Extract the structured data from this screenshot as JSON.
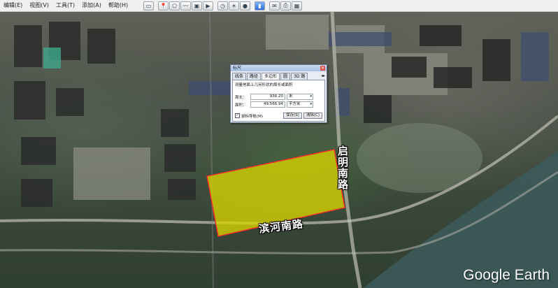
{
  "menu": [
    "编辑(E)",
    "视图(V)",
    "工具(T)",
    "添加(A)",
    "帮助(H)"
  ],
  "toolbar": {
    "icons": [
      "sidebar-icon",
      "placemark-icon",
      "polygon-icon",
      "path-icon",
      "overlay-icon",
      "tour-icon",
      "history-icon",
      "sun-icon",
      "planet-icon",
      "ruler-icon",
      "email-icon",
      "print-icon",
      "map-icon"
    ],
    "active_index": 9
  },
  "dialog": {
    "title": "标尺",
    "tabs": [
      "线条",
      "路径",
      "多边形",
      "圆",
      "3D 路"
    ],
    "active_tab": 2,
    "description": "测量地面上几何形状的周长或面积",
    "perimeter": {
      "label": "周长：",
      "value": "936.20",
      "unit": "米"
    },
    "area": {
      "label": "面积：",
      "value": "49,566.94",
      "unit": "平方米"
    },
    "mouse_nav_label": "鼠标导航(M)",
    "save_label": "保存(S)",
    "clear_label": "清除(C)"
  },
  "roads": {
    "vertical": "启明南路",
    "horizontal": "滨河南路"
  },
  "watermark": "Google Earth"
}
